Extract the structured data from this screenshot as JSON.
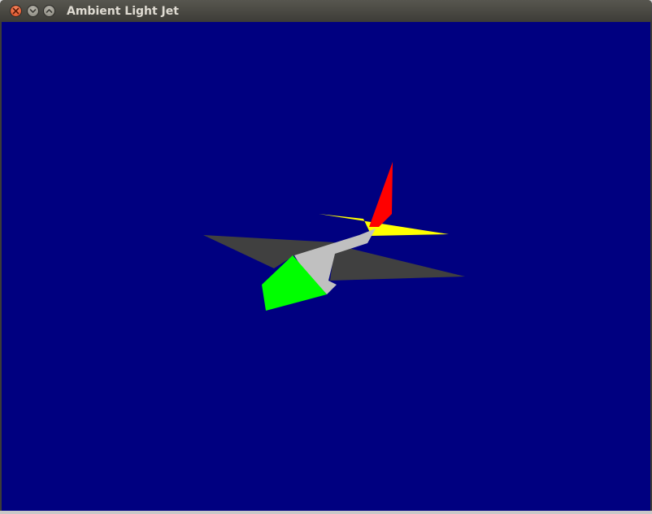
{
  "window": {
    "title": "Ambient Light Jet",
    "buttons": {
      "close": "close-icon",
      "minimize": "minimize-icon",
      "maximize": "maximize-icon"
    }
  },
  "scene": {
    "background_color": "#000080",
    "object": "jet",
    "part_colors": {
      "fuselage": "#c0c0c0",
      "wings": "#404040",
      "tail_wings": "#ffff00",
      "tail_fin": "#ff0000",
      "nose": "#00ff00"
    }
  }
}
